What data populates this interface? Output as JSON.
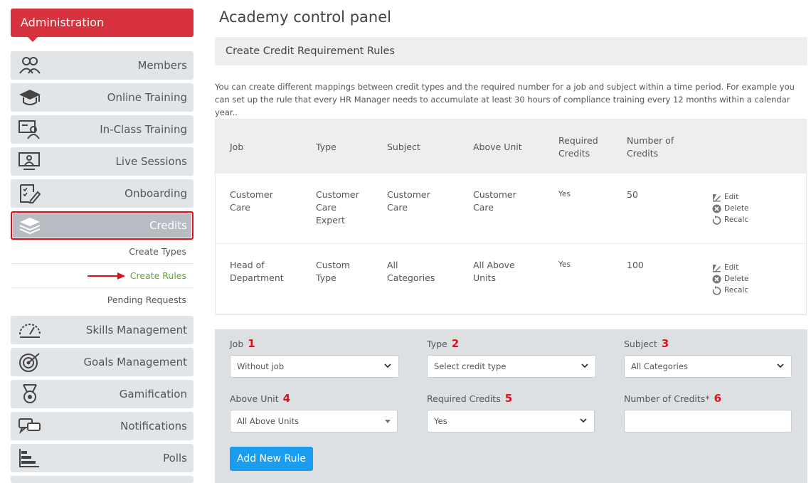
{
  "sidebar": {
    "header": "Administration",
    "items": [
      {
        "label": "Members",
        "icon": "members-icon"
      },
      {
        "label": "Online Training",
        "icon": "graduation-cap-icon"
      },
      {
        "label": "In-Class Training",
        "icon": "classroom-icon"
      },
      {
        "label": "Live Sessions",
        "icon": "live-session-icon"
      },
      {
        "label": "Onboarding",
        "icon": "checklist-icon"
      },
      {
        "label": "Credits",
        "icon": "layers-icon"
      }
    ],
    "credits_submenu": [
      "Create Types",
      "Create Rules",
      "Pending Requests"
    ],
    "items_after": [
      {
        "label": "Skills Management",
        "icon": "gauge-icon"
      },
      {
        "label": "Goals Management",
        "icon": "target-icon"
      },
      {
        "label": "Gamification",
        "icon": "medal-icon"
      },
      {
        "label": "Notifications",
        "icon": "chat-bubbles-icon"
      },
      {
        "label": "Polls",
        "icon": "bar-chart-icon"
      }
    ]
  },
  "main": {
    "title": "Academy control panel",
    "section_title": "Create Credit Requirement Rules",
    "intro": "You can create different mappings between credit types and the required number for a job and subject within a time period. For example you can set up the rule that every HR Manager needs to accumulate at least 30 hours of compliance training every 12 months within a calendar year..",
    "table": {
      "headers": {
        "job": "Job",
        "type": "Type",
        "subject": "Subject",
        "unit": "Above Unit",
        "req_line1": "Required",
        "req_line2": "Credits",
        "num_line1": "Number of",
        "num_line2": "Credits"
      },
      "rows": [
        {
          "job": [
            "Customer",
            "Care"
          ],
          "type": [
            "Customer",
            "Care",
            "Expert"
          ],
          "subject": [
            "Customer",
            "Care"
          ],
          "unit": [
            "Customer",
            "Care"
          ],
          "required": "Yes",
          "number": "50"
        },
        {
          "job": [
            "Head of",
            "Department"
          ],
          "type": [
            "Custom",
            "Type"
          ],
          "subject": [
            "All",
            "Categories"
          ],
          "unit": [
            "All Above",
            "Units"
          ],
          "required": "Yes",
          "number": "100"
        }
      ],
      "actions": {
        "edit": "Edit",
        "delete": "Delete",
        "recalc": "Recalc"
      }
    },
    "form": {
      "job": {
        "label": "Job",
        "num": "1",
        "value": "Without job"
      },
      "type": {
        "label": "Type",
        "num": "2",
        "value": "Select credit type"
      },
      "subject": {
        "label": "Subject",
        "num": "3",
        "value": "All Categories"
      },
      "unit": {
        "label": "Above Unit",
        "num": "4",
        "value": "All Above Units"
      },
      "required": {
        "label": "Required Credits",
        "num": "5",
        "value": "Yes"
      },
      "credits": {
        "label": "Number of Credits*",
        "num": "6",
        "value": ""
      },
      "add_button": "Add New Rule"
    }
  },
  "colors": {
    "brand_red": "#d8323f",
    "active_link": "#5ba632",
    "button_blue": "#1a9df0",
    "annotation_red": "#e0101a"
  }
}
